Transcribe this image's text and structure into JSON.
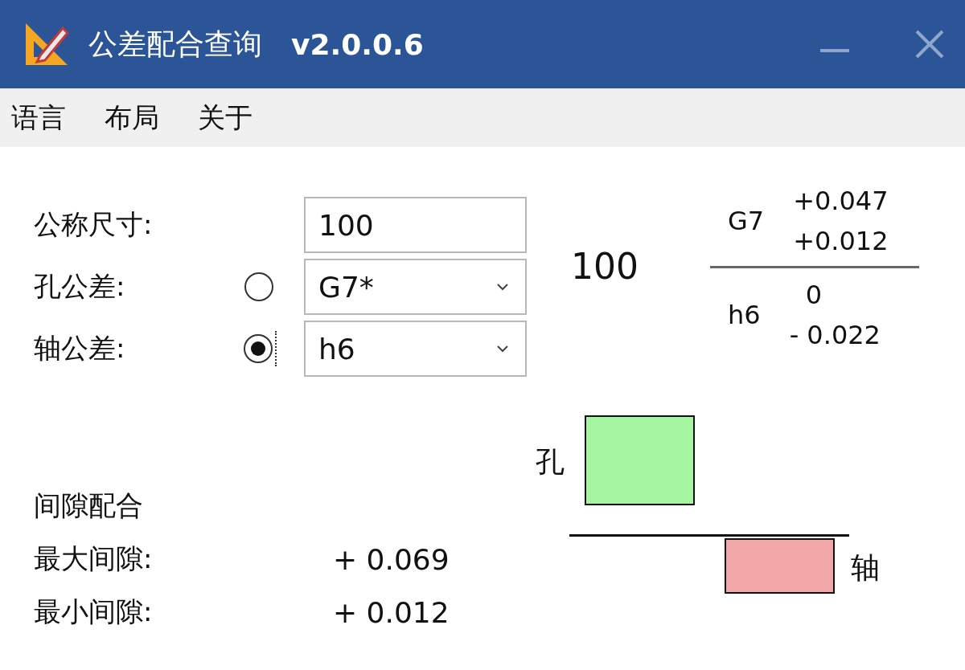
{
  "window": {
    "title": "公差配合查询",
    "version": "v2.0.0.6"
  },
  "menu": [
    {
      "label": "语言"
    },
    {
      "label": "布局"
    },
    {
      "label": "关于"
    }
  ],
  "form": {
    "nominal_size": {
      "label": "公称尺寸:",
      "value": "100"
    },
    "tolerances": [
      {
        "label": "孔公差:",
        "value": "G7*",
        "selected": false,
        "focused": false
      },
      {
        "label": "轴公差:",
        "value": "h6",
        "selected": true,
        "focused": true
      }
    ]
  },
  "fit_notation": {
    "size": "100",
    "hole": {
      "grade": "G7",
      "upper": "+0.047",
      "lower": "+0.012"
    },
    "shaft": {
      "grade": "h6",
      "upper": "0",
      "lower": "- 0.022"
    }
  },
  "diagram": {
    "hole_label": "孔",
    "shaft_label": "轴"
  },
  "result": {
    "fit_type": "间隙配合",
    "rows": [
      {
        "label": "最大间隙:",
        "value": "+ 0.069"
      },
      {
        "label": "最小间隙:",
        "value": "+ 0.012"
      }
    ]
  }
}
